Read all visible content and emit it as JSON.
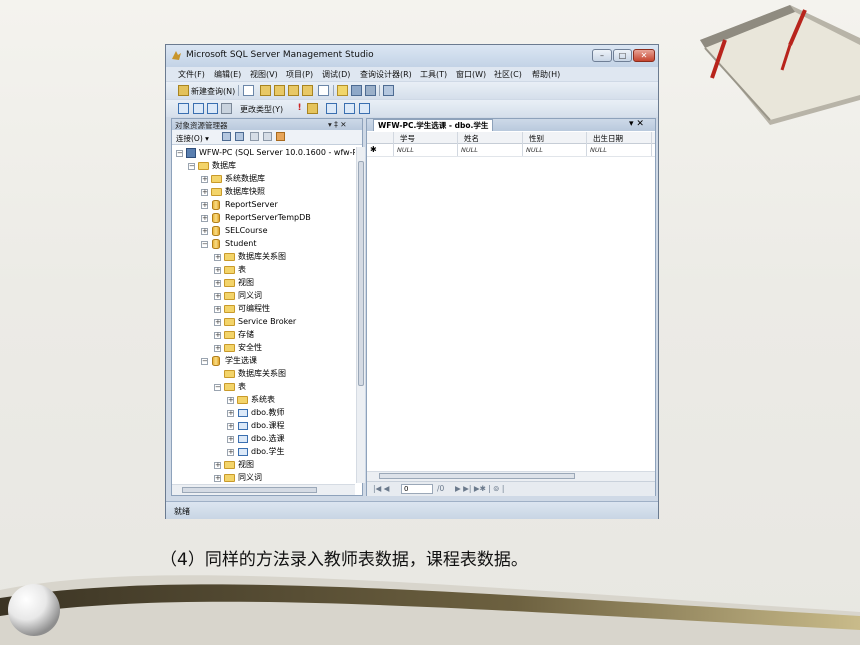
{
  "window": {
    "title": "Microsoft SQL Server Management Studio"
  },
  "menus": [
    "文件(F)",
    "编辑(E)",
    "视图(V)",
    "项目(P)",
    "调试(D)",
    "查询设计器(R)",
    "工具(T)",
    "窗口(W)",
    "社区(C)",
    "帮助(H)"
  ],
  "toolbar": {
    "new_query": "新建查询(N)",
    "change_type": "更改类型(Y)"
  },
  "object_explorer": {
    "title": "对象资源管理器",
    "header_controls": "▾ ‡ ✕",
    "connect": "连接(O) ▾",
    "server": "WFW-PC (SQL Server 10.0.1600 - wfw-P(",
    "nodes": [
      "数据库",
      "系统数据库",
      "数据库快照",
      "ReportServer",
      "ReportServerTempDB",
      "SELCourse",
      "Student",
      "数据库关系图",
      "表",
      "视图",
      "同义词",
      "可编程性",
      "Service Broker",
      "存储",
      "安全性",
      "学生选课",
      "数据库关系图",
      "表",
      "系统表",
      "dbo.教师",
      "dbo.课程",
      "dbo.选课",
      "dbo.学生",
      "视图",
      "同义词"
    ]
  },
  "document": {
    "tab": "WFW-PC.学生选课 - dbo.学生",
    "tab_controls": "▾ ✕",
    "columns": [
      "学号",
      "姓名",
      "性别",
      "出生日期"
    ],
    "row_marker": "✱",
    "new_row": [
      "NULL",
      "NULL",
      "NULL",
      "NULL"
    ],
    "nav_prev": "|◀ ◀",
    "nav_value": "0",
    "nav_of": "/0",
    "nav_next": "▶ ▶| ▶✱ | ⊚ |"
  },
  "status": "就绪",
  "caption": "（4）同样的方法录入教师表数据，课程表数据。"
}
